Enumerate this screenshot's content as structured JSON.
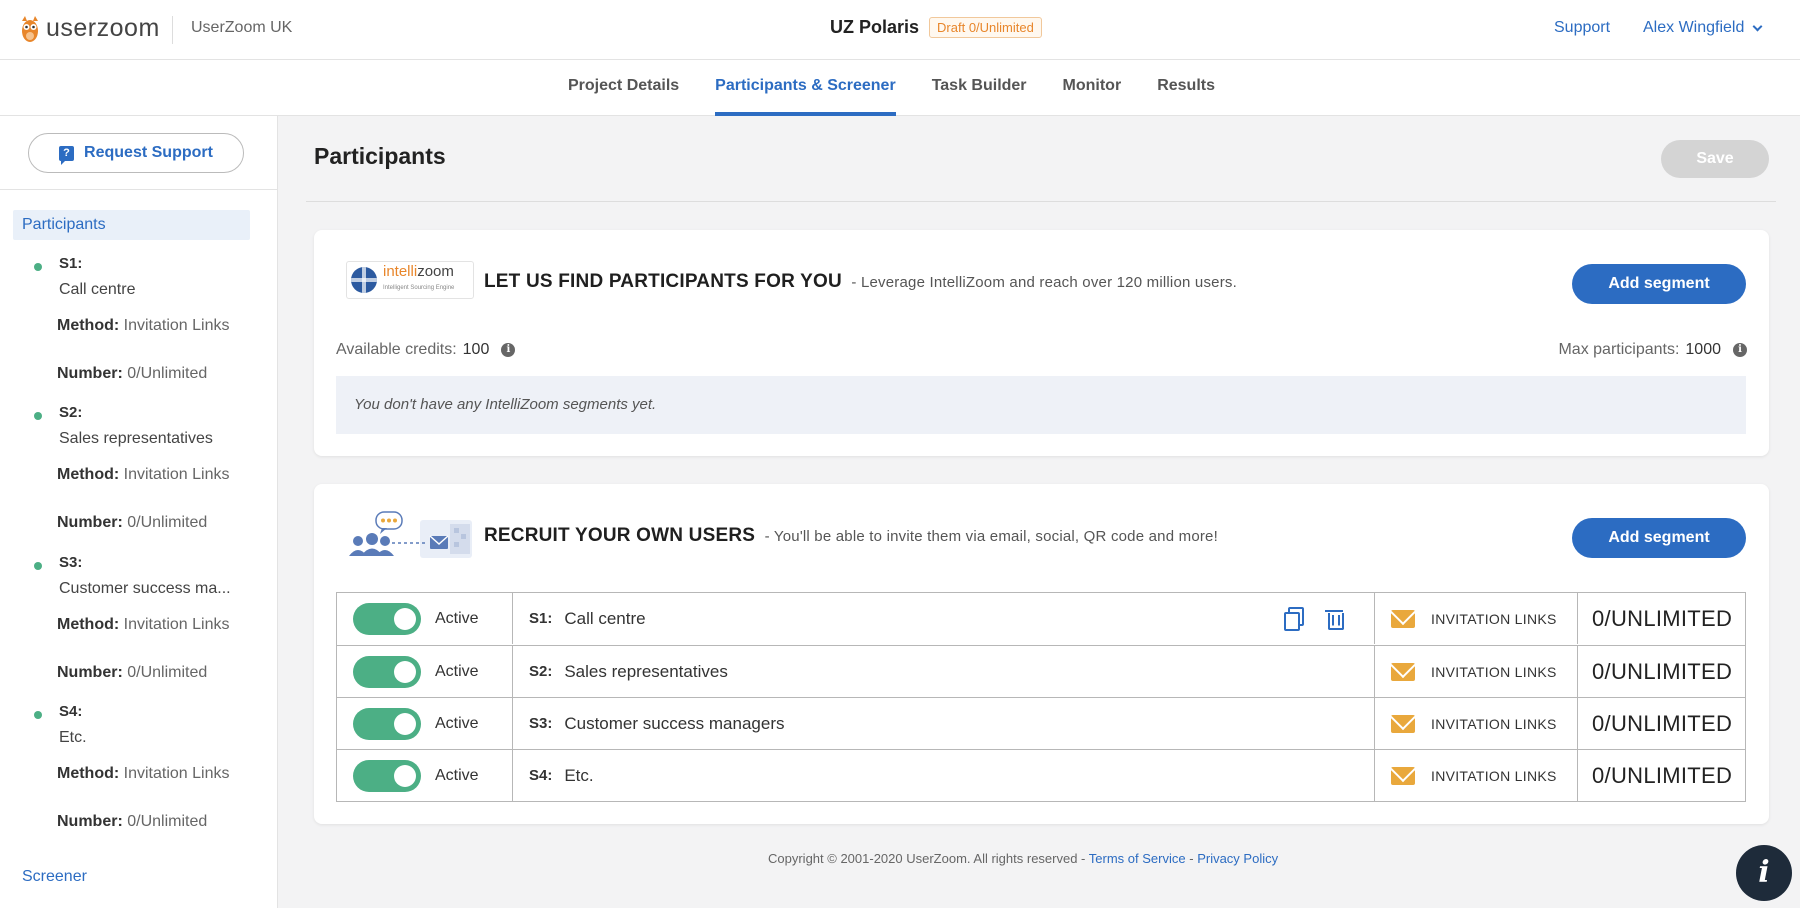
{
  "header": {
    "logo_text": "userzoom",
    "org_name": "UserZoom UK",
    "project_title": "UZ Polaris",
    "draft_badge": "Draft 0/Unlimited",
    "support_label": "Support",
    "user_name": "Alex Wingfield"
  },
  "nav": {
    "tabs": [
      {
        "label": "Project Details"
      },
      {
        "label": "Participants & Screener"
      },
      {
        "label": "Task Builder"
      },
      {
        "label": "Monitor"
      },
      {
        "label": "Results"
      }
    ],
    "active_tab": "Participants & Screener"
  },
  "sidebar": {
    "request_support_label": "Request Support",
    "participants_label": "Participants",
    "method_label": "Method:",
    "number_label": "Number:",
    "segments": [
      {
        "id": "S1:",
        "name": "Call centre",
        "method": "Invitation Links",
        "number": "0/Unlimited"
      },
      {
        "id": "S2:",
        "name": "Sales representatives",
        "method": "Invitation Links",
        "number": "0/Unlimited"
      },
      {
        "id": "S3:",
        "name": "Customer success ma...",
        "method": "Invitation Links",
        "number": "0/Unlimited"
      },
      {
        "id": "S4:",
        "name": "Etc.",
        "method": "Invitation Links",
        "number": "0/Unlimited"
      }
    ],
    "screener_label": "Screener"
  },
  "main": {
    "title": "Participants",
    "save_label": "Save",
    "intellizoom": {
      "logo_a": "intelli",
      "logo_b": "zoom",
      "logo_sub": "Intelligent Sourcing Engine",
      "heading": "LET US FIND PARTICIPANTS FOR YOU",
      "description": "- Leverage IntelliZoom and reach over 120 million users.",
      "add_label": "Add segment",
      "credits_label": "Available credits:",
      "credits_value": "100",
      "max_label": "Max participants:",
      "max_value": "1000",
      "empty_text": "You don't have any IntelliZoom segments yet."
    },
    "recruit": {
      "heading": "RECRUIT YOUR OWN USERS",
      "description": "- You'll be able to invite them via email, social, QR code and more!",
      "add_label": "Add segment",
      "rows": [
        {
          "status": "Active",
          "id": "S1:",
          "name": "Call centre",
          "method": "INVITATION LINKS",
          "number": "0/UNLIMITED"
        },
        {
          "status": "Active",
          "id": "S2:",
          "name": "Sales representatives",
          "method": "INVITATION LINKS",
          "number": "0/UNLIMITED"
        },
        {
          "status": "Active",
          "id": "S3:",
          "name": "Customer success managers",
          "method": "INVITATION LINKS",
          "number": "0/UNLIMITED"
        },
        {
          "status": "Active",
          "id": "S4:",
          "name": "Etc.",
          "method": "INVITATION LINKS",
          "number": "0/UNLIMITED"
        }
      ]
    }
  },
  "footer": {
    "copyright": "Copyright © 2001-2020 UserZoom. All rights reserved -",
    "terms_label": "Terms of Service",
    "sep": "-",
    "privacy_label": "Privacy Policy"
  },
  "colors": {
    "accent": "#2c6cc2",
    "active_green": "#4caf85",
    "draft_orange": "#e8862b",
    "mail_yellow": "#e9a83c"
  },
  "icons": [
    "owl-logo-icon",
    "chevron-down-icon",
    "question-chat-icon",
    "info-icon",
    "globe-icon",
    "copy-icon",
    "trash-icon",
    "mail-icon",
    "info-fab-icon"
  ]
}
